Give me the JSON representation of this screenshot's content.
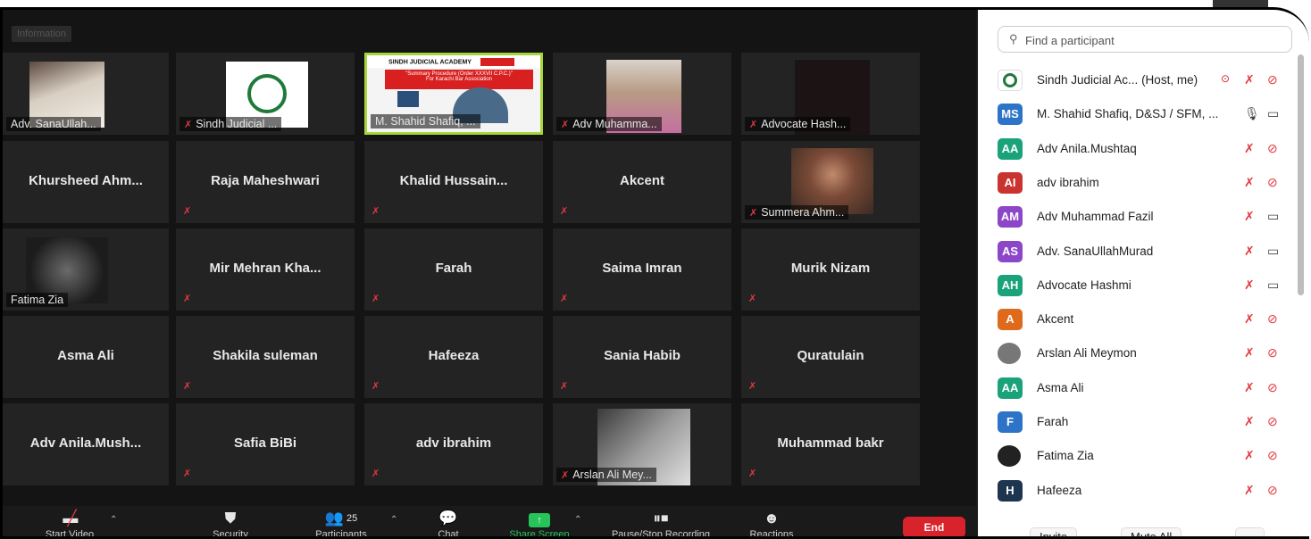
{
  "info_chip": "Information",
  "tiles": [
    {
      "type": "photo",
      "label": "Adv. SanaUllah...",
      "muted": false
    },
    {
      "type": "logo",
      "label": "Sindh Judicial ...",
      "muted": true
    },
    {
      "type": "share",
      "label": "M. Shahid Shafiq, ...",
      "muted": false,
      "slide_title": "SINDH JUDICIAL ACADEMY",
      "slide_sub": "\"Summary Procedure (Order XXXVII C.P.C.)\"",
      "slide_sub2": "For Karachi Bar Association"
    },
    {
      "type": "photo",
      "label": "Adv Muhamma...",
      "muted": true
    },
    {
      "type": "photo",
      "label": "Advocate Hash...",
      "muted": true
    },
    {
      "type": "name",
      "name": "Khursheed Ahm...",
      "muted": false
    },
    {
      "type": "name",
      "name": "Raja Maheshwari",
      "muted": true
    },
    {
      "type": "name",
      "name": "Khalid  Hussain...",
      "muted": true
    },
    {
      "type": "name",
      "name": "Akcent",
      "muted": true
    },
    {
      "type": "photo",
      "label": "Summera Ahm...",
      "muted": true
    },
    {
      "type": "photo",
      "label": "Fatima Zia",
      "muted": false
    },
    {
      "type": "name",
      "name": "Mir  Mehran  Kha...",
      "muted": true
    },
    {
      "type": "name",
      "name": "Farah",
      "muted": true
    },
    {
      "type": "name",
      "name": "Saima Imran",
      "muted": true
    },
    {
      "type": "name",
      "name": "Murik Nizam",
      "muted": true
    },
    {
      "type": "name",
      "name": "Asma Ali",
      "muted": false
    },
    {
      "type": "name",
      "name": "Shakila suleman",
      "muted": true
    },
    {
      "type": "name",
      "name": "Hafeeza",
      "muted": true
    },
    {
      "type": "name",
      "name": "Sania Habib",
      "muted": true
    },
    {
      "type": "name",
      "name": "Quratulain",
      "muted": true
    },
    {
      "type": "name",
      "name": "Adv  Anila.Mush...",
      "muted": false
    },
    {
      "type": "name",
      "name": "Safia BiBi",
      "muted": true
    },
    {
      "type": "name",
      "name": "adv ibrahim",
      "muted": true
    },
    {
      "type": "photo",
      "label": "Arslan Ali Mey...",
      "muted": true
    },
    {
      "type": "name",
      "name": "Muhammad bakr",
      "muted": true
    }
  ],
  "toolbar": {
    "start_video": "Start Video",
    "security": "Security",
    "participants": "Participants",
    "participants_count": "25",
    "chat": "Chat",
    "share_screen": "Share Screen",
    "recording": "Pause/Stop Recording",
    "reactions": "Reactions",
    "end": "End"
  },
  "panel": {
    "search_placeholder": "Find a participant",
    "participants": [
      {
        "initials": "",
        "name": "Sindh Judicial Ac... (Host, me)",
        "color": "#ffffff",
        "host": true,
        "mic": "muted",
        "cam": "off"
      },
      {
        "initials": "MS",
        "name": "M. Shahid Shafiq, D&SJ / SFM, ...",
        "color": "#2d74c9",
        "mic": "on",
        "cam": "on"
      },
      {
        "initials": "AA",
        "name": "Adv Anila.Mushtaq",
        "color": "#1aa37a",
        "mic": "muted",
        "cam": "off"
      },
      {
        "initials": "AI",
        "name": "adv ibrahim",
        "color": "#c9352e",
        "mic": "muted",
        "cam": "off"
      },
      {
        "initials": "AM",
        "name": "Adv Muhammad Fazil",
        "color": "#8c47c9",
        "mic": "muted",
        "cam": "on"
      },
      {
        "initials": "AS",
        "name": "Adv. SanaUllahMurad",
        "color": "#8c47c9",
        "mic": "muted",
        "cam": "on"
      },
      {
        "initials": "AH",
        "name": "Advocate Hashmi",
        "color": "#1aa37a",
        "mic": "muted",
        "cam": "on"
      },
      {
        "initials": "A",
        "name": "Akcent",
        "color": "#e06a1b",
        "mic": "muted",
        "cam": "off"
      },
      {
        "initials": "",
        "name": "Arslan Ali Meymon",
        "color": "#777777",
        "photo": true,
        "mic": "muted",
        "cam": "off"
      },
      {
        "initials": "AA",
        "name": "Asma Ali",
        "color": "#1aa37a",
        "mic": "muted",
        "cam": "off"
      },
      {
        "initials": "F",
        "name": "Farah",
        "color": "#2d74c9",
        "mic": "muted",
        "cam": "off"
      },
      {
        "initials": "",
        "name": "Fatima Zia",
        "color": "#222222",
        "photo": true,
        "mic": "muted",
        "cam": "off"
      },
      {
        "initials": "H",
        "name": "Hafeeza",
        "color": "#1e3550",
        "mic": "muted",
        "cam": "off"
      }
    ],
    "invite": "Invite",
    "mute_all": "Mute All",
    "more": "..."
  },
  "colors": {
    "muted": "#e0383e",
    "end": "#d9232c",
    "share": "#26c45a",
    "active_border": "#a8d63a"
  }
}
